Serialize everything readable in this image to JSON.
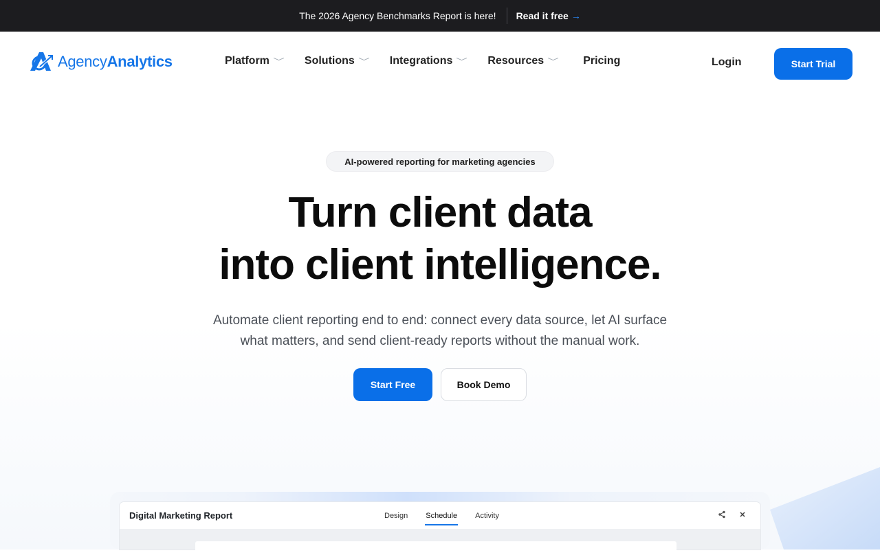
{
  "announcement": {
    "message": "The 2026 Agency Benchmarks Report is here!",
    "cta_label": "Read it free",
    "cta_arrow": "→"
  },
  "brand": {
    "name_light": "Agency",
    "name_bold": "Analytics",
    "color": "#1676e8"
  },
  "nav": {
    "items": [
      {
        "label": "Platform",
        "has_dropdown": true
      },
      {
        "label": "Solutions",
        "has_dropdown": true
      },
      {
        "label": "Integrations",
        "has_dropdown": true
      },
      {
        "label": "Resources",
        "has_dropdown": true
      },
      {
        "label": "Pricing",
        "has_dropdown": false
      }
    ],
    "chevron": "﹀",
    "login_label": "Login",
    "trial_label": "Start Trial"
  },
  "hero": {
    "badge": "AI-powered reporting for marketing agencies",
    "headline_line1": "Turn client data",
    "headline_line2": "into client intelligence.",
    "subtext_line1": "Automate client reporting end to end: connect every data source, let AI surface",
    "subtext_line2": "what matters, and send client-ready reports without the manual work.",
    "primary_cta": "Start Free",
    "secondary_cta": "Book Demo",
    "accent_color": "#0a6fe8"
  },
  "preview": {
    "title": "Digital Marketing Report",
    "tabs": [
      {
        "label": "Design",
        "active": false
      },
      {
        "label": "Schedule",
        "active": true
      },
      {
        "label": "Activity",
        "active": false
      }
    ],
    "share_icon": "share-icon",
    "close_icon": "close-icon"
  }
}
